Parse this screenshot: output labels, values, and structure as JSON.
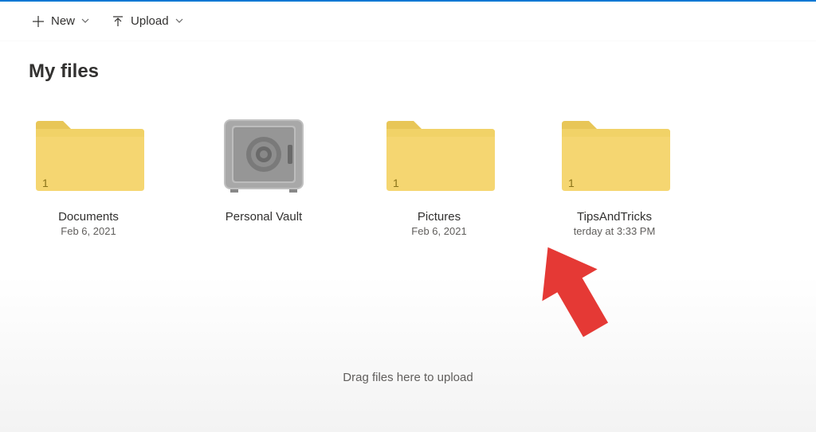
{
  "toolbar": {
    "new_label": "New",
    "upload_label": "Upload"
  },
  "page": {
    "title": "My files",
    "drop_hint": "Drag files here to upload"
  },
  "items": [
    {
      "name": "Documents",
      "date": "Feb 6, 2021",
      "count": "1",
      "type": "folder"
    },
    {
      "name": "Personal Vault",
      "date": "",
      "count": "",
      "type": "vault"
    },
    {
      "name": "Pictures",
      "date": "Feb 6, 2021",
      "count": "1",
      "type": "folder"
    },
    {
      "name": "TipsAndTricks",
      "date": "terday at 3:33 PM",
      "count": "1",
      "type": "folder"
    }
  ]
}
